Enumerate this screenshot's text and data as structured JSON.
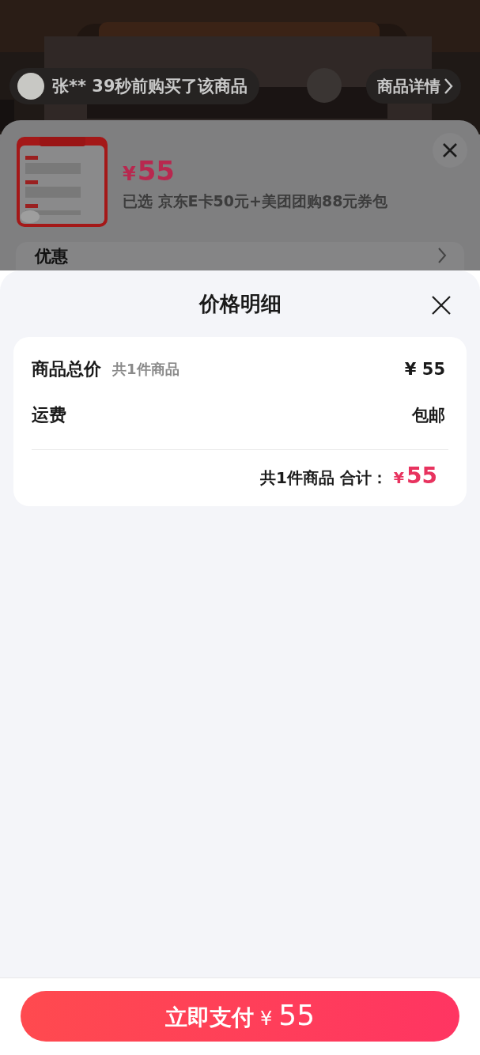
{
  "purchase_notice": {
    "text": "张** 39秒前购买了该商品"
  },
  "details_link": {
    "label": "商品详情"
  },
  "product": {
    "currency": "¥",
    "price": "55",
    "selection": "已选 京东E卡50元+美团团购88元券包"
  },
  "discount_row": {
    "label": "优惠"
  },
  "price_detail": {
    "title": "价格明细",
    "rows": [
      {
        "label": "商品总价",
        "note": "共1件商品",
        "value": "¥ 55"
      },
      {
        "label": "运费",
        "value": "包邮"
      }
    ],
    "total": {
      "label": "共1件商品 合计：",
      "currency": "¥",
      "amount": "55"
    }
  },
  "pay_button": {
    "label": "立即支付",
    "currency": "¥",
    "amount": "55"
  }
}
